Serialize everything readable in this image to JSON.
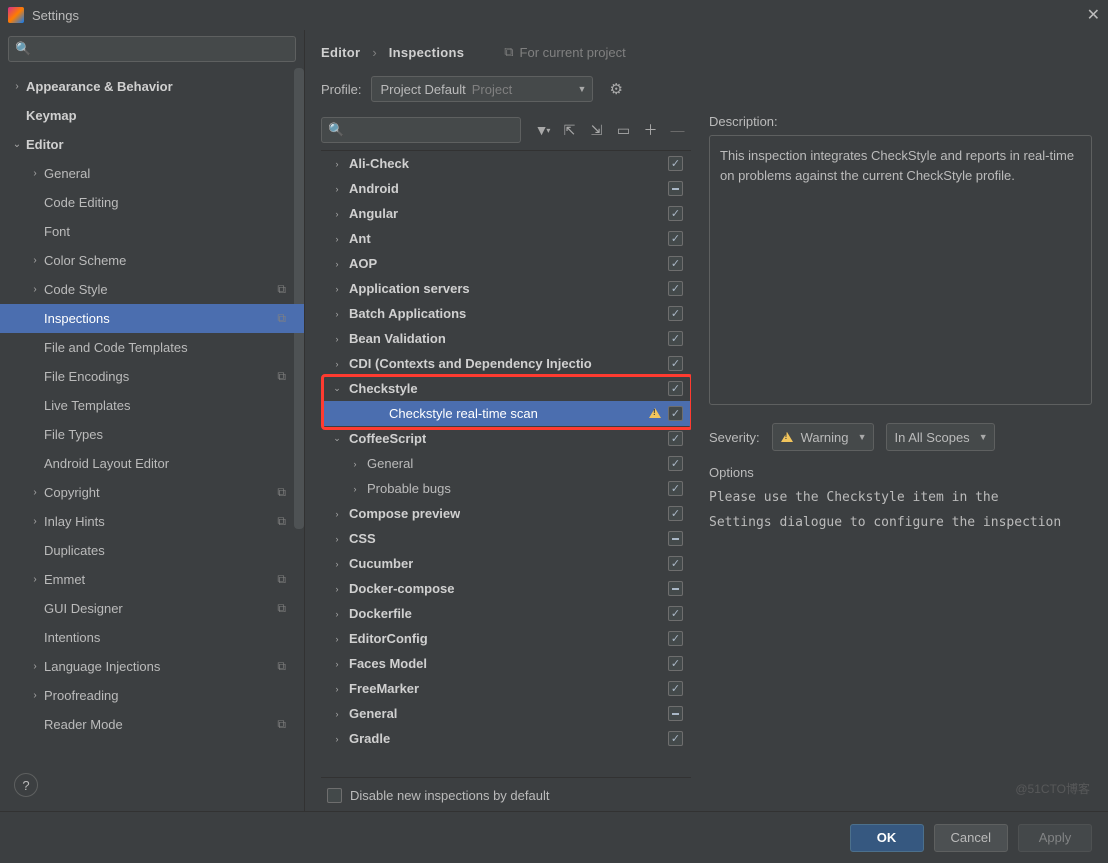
{
  "window": {
    "title": "Settings"
  },
  "breadcrumb": {
    "p1": "Editor",
    "p2": "Inspections",
    "proj": "For current project"
  },
  "profile": {
    "label": "Profile:",
    "value": "Project Default",
    "scope": "Project"
  },
  "sidebar": {
    "items": [
      {
        "label": "Appearance & Behavior",
        "arrow": "›",
        "bold": true,
        "depth": 0
      },
      {
        "label": "Keymap",
        "arrow": "",
        "bold": true,
        "depth": 0
      },
      {
        "label": "Editor",
        "arrow": "⌄",
        "bold": true,
        "depth": 0
      },
      {
        "label": "General",
        "arrow": "›",
        "depth": 1
      },
      {
        "label": "Code Editing",
        "arrow": "",
        "depth": 1
      },
      {
        "label": "Font",
        "arrow": "",
        "depth": 1
      },
      {
        "label": "Color Scheme",
        "arrow": "›",
        "depth": 1
      },
      {
        "label": "Code Style",
        "arrow": "›",
        "depth": 1,
        "copy": true
      },
      {
        "label": "Inspections",
        "arrow": "",
        "depth": 1,
        "sel": true,
        "copy": true
      },
      {
        "label": "File and Code Templates",
        "arrow": "",
        "depth": 1
      },
      {
        "label": "File Encodings",
        "arrow": "",
        "depth": 1,
        "copy": true
      },
      {
        "label": "Live Templates",
        "arrow": "",
        "depth": 1
      },
      {
        "label": "File Types",
        "arrow": "",
        "depth": 1
      },
      {
        "label": "Android Layout Editor",
        "arrow": "",
        "depth": 1
      },
      {
        "label": "Copyright",
        "arrow": "›",
        "depth": 1,
        "copy": true
      },
      {
        "label": "Inlay Hints",
        "arrow": "›",
        "depth": 1,
        "copy": true
      },
      {
        "label": "Duplicates",
        "arrow": "",
        "depth": 1
      },
      {
        "label": "Emmet",
        "arrow": "›",
        "depth": 1,
        "copy": true
      },
      {
        "label": "GUI Designer",
        "arrow": "",
        "depth": 1,
        "copy": true
      },
      {
        "label": "Intentions",
        "arrow": "",
        "depth": 1
      },
      {
        "label": "Language Injections",
        "arrow": "›",
        "depth": 1,
        "copy": true
      },
      {
        "label": "Proofreading",
        "arrow": "›",
        "depth": 1
      },
      {
        "label": "Reader Mode",
        "arrow": "",
        "depth": 1,
        "copy": true
      }
    ]
  },
  "inspections": {
    "items": [
      {
        "name": "Ali-Check",
        "arrow": "›",
        "chk": "on",
        "depth": 0
      },
      {
        "name": "Android",
        "arrow": "›",
        "chk": "mix",
        "depth": 0
      },
      {
        "name": "Angular",
        "arrow": "›",
        "chk": "on",
        "depth": 0
      },
      {
        "name": "Ant",
        "arrow": "›",
        "chk": "on",
        "depth": 0
      },
      {
        "name": "AOP",
        "arrow": "›",
        "chk": "on",
        "depth": 0
      },
      {
        "name": "Application servers",
        "arrow": "›",
        "chk": "on",
        "depth": 0
      },
      {
        "name": "Batch Applications",
        "arrow": "›",
        "chk": "on",
        "depth": 0
      },
      {
        "name": "Bean Validation",
        "arrow": "›",
        "chk": "on",
        "depth": 0
      },
      {
        "name": "CDI (Contexts and Dependency Injectio",
        "arrow": "›",
        "chk": "on",
        "depth": 0
      },
      {
        "name": "Checkstyle",
        "arrow": "⌄",
        "chk": "on",
        "depth": 0,
        "boxed": true
      },
      {
        "name": "Checkstyle real-time scan",
        "arrow": "",
        "chk": "on",
        "depth": 2,
        "sel": true,
        "warn": true,
        "boxed": true
      },
      {
        "name": "CoffeeScript",
        "arrow": "⌄",
        "chk": "on",
        "depth": 0
      },
      {
        "name": "General",
        "arrow": "›",
        "chk": "on",
        "depth": 1
      },
      {
        "name": "Probable bugs",
        "arrow": "›",
        "chk": "on",
        "depth": 1
      },
      {
        "name": "Compose preview",
        "arrow": "›",
        "chk": "on",
        "depth": 0
      },
      {
        "name": "CSS",
        "arrow": "›",
        "chk": "mix",
        "depth": 0
      },
      {
        "name": "Cucumber",
        "arrow": "›",
        "chk": "on",
        "depth": 0
      },
      {
        "name": "Docker-compose",
        "arrow": "›",
        "chk": "mix",
        "depth": 0
      },
      {
        "name": "Dockerfile",
        "arrow": "›",
        "chk": "on",
        "depth": 0
      },
      {
        "name": "EditorConfig",
        "arrow": "›",
        "chk": "on",
        "depth": 0
      },
      {
        "name": "Faces Model",
        "arrow": "›",
        "chk": "on",
        "depth": 0
      },
      {
        "name": "FreeMarker",
        "arrow": "›",
        "chk": "on",
        "depth": 0
      },
      {
        "name": "General",
        "arrow": "›",
        "chk": "mix",
        "depth": 0
      },
      {
        "name": "Gradle",
        "arrow": "›",
        "chk": "on",
        "depth": 0
      }
    ],
    "footer": "Disable new inspections by default"
  },
  "details": {
    "descLabel": "Description:",
    "descText": "This inspection integrates CheckStyle and reports in real-time on problems against the current CheckStyle profile.",
    "sevLabel": "Severity:",
    "sevValue": "Warning",
    "scopeValue": "In All Scopes",
    "optLabel": "Options",
    "optText": "Please use the Checkstyle item in the\nSettings dialogue to configure the inspection"
  },
  "buttons": {
    "ok": "OK",
    "cancel": "Cancel",
    "apply": "Apply"
  },
  "watermark": "@51CTO博客"
}
